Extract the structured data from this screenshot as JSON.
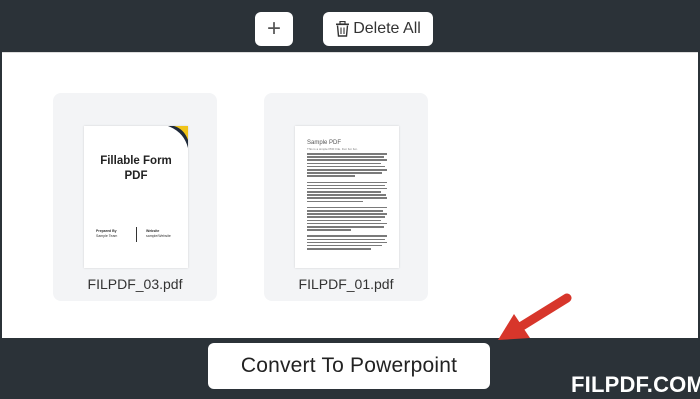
{
  "toolbar": {
    "add_label": "+",
    "delete_all_label": "Delete All"
  },
  "files": [
    {
      "name": "FILPDF_03.pdf",
      "thumbnail": {
        "title_line1": "Fillable Form",
        "title_line2": "PDF",
        "left_line1": "Prepared By",
        "left_line2": "Sample Team",
        "right_line1": "Website",
        "right_line2": "sample/Website"
      }
    },
    {
      "name": "FILPDF_01.pdf",
      "thumbnail": {
        "title": "Sample PDF",
        "subtitle": "This is a simple PDF File. Fun fun fun."
      }
    }
  ],
  "convert_button_label": "Convert To Powerpoint",
  "watermark": "FILPDF.COM",
  "colors": {
    "frame": "#2b3238",
    "arrow": "#d7362b",
    "card_bg": "#f3f4f6"
  }
}
